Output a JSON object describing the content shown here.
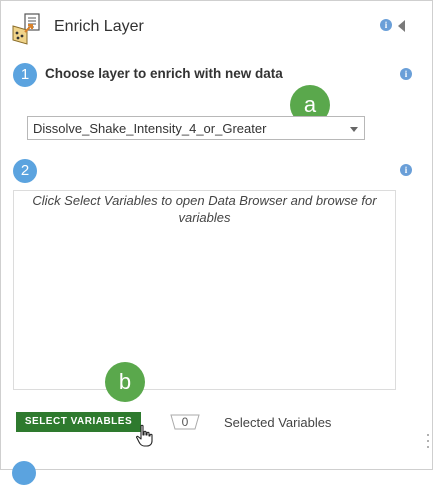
{
  "header": {
    "title": "Enrich Layer",
    "info_icon": "i"
  },
  "step1": {
    "number": "1",
    "label": "Choose layer to enrich with new data",
    "info_icon": "i",
    "layer_select": {
      "value": "Dissolve_Shake_Intensity_4_or_Greater"
    }
  },
  "step2": {
    "number": "2",
    "info_icon": "i",
    "hint": "Click Select Variables to open Data Browser and browse for variables",
    "select_button": "SELECT VARIABLES",
    "selected_count": "0",
    "selected_label": "Selected Variables"
  },
  "callouts": {
    "a": "a",
    "b": "b"
  },
  "colors": {
    "step_blue": "#5ba3df",
    "callout_green": "#5aa84c",
    "button_green": "#2e7a2e",
    "info_blue": "#6a9fd8"
  }
}
